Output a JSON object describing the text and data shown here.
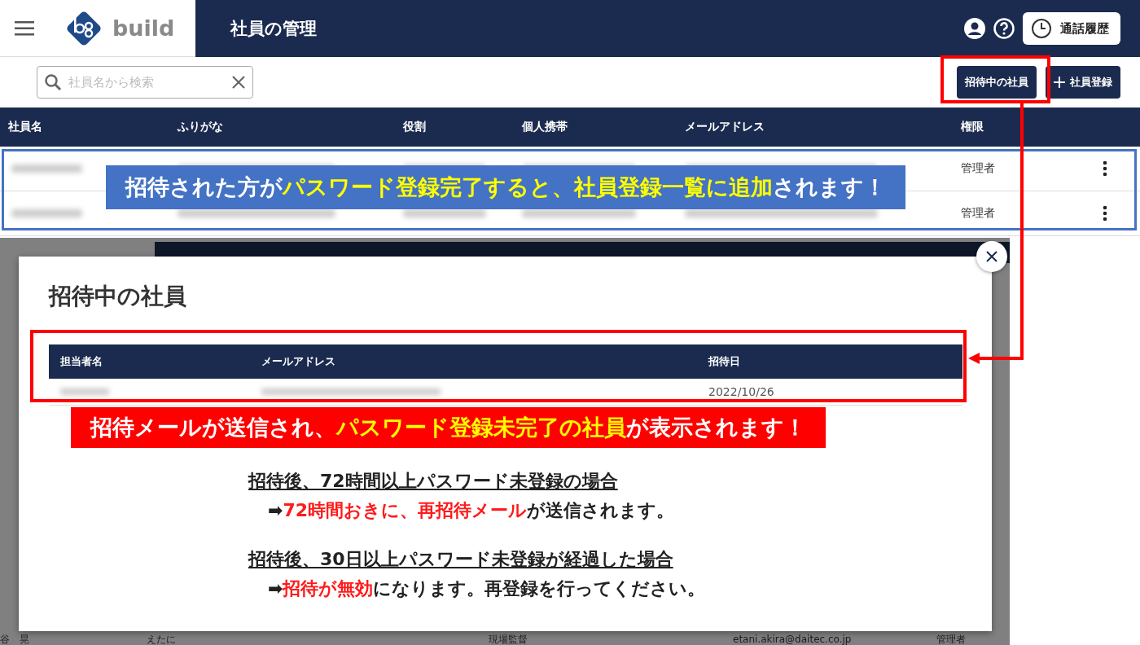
{
  "header": {
    "logo_text": "build",
    "title": "社員の管理",
    "history_button": "通話履歴"
  },
  "toolbar": {
    "search": {
      "placeholder": "社員名から検索"
    },
    "buttons": [
      {
        "kind": "invited",
        "label": "招待中の社員"
      },
      {
        "kind": "add",
        "label": "社員登録"
      }
    ]
  },
  "table": {
    "columns": [
      "社員名",
      "ふりがな",
      "役割",
      "個人携帯",
      "メールアドレス",
      "権限"
    ],
    "rows": [
      {
        "authority": "管理者"
      },
      {
        "authority": "管理者"
      }
    ]
  },
  "background_row": {
    "cells": [
      "谷　晃",
      "えたに",
      "現場監督",
      "etani.akira@daitec.co.jp",
      "管理者"
    ]
  },
  "modal": {
    "title": "招待中の社員",
    "columns": [
      "担当者名",
      "メールアドレス",
      "招待日"
    ],
    "rows": [
      {
        "invited_date": "2022/10/26"
      }
    ],
    "notes": [
      {
        "heading": "招待後、72時間以上パスワード未登録の場合",
        "arrow": "➡",
        "segments": [
          {
            "text": "72時間おきに、再招待メール",
            "highlight": true
          },
          {
            "text": "が送信されます。",
            "highlight": false
          }
        ]
      },
      {
        "heading": "招待後、30日以上パスワード未登録が経過した場合",
        "arrow": "➡",
        "segments": [
          {
            "text": "招待が無効",
            "highlight": true
          },
          {
            "text": "になります。再登録を行ってください。",
            "highlight": false
          }
        ]
      }
    ]
  },
  "callouts": [
    {
      "kind": "blue",
      "segments": [
        {
          "text": "招待された方が",
          "highlight": false
        },
        {
          "text": "パスワード登録完了すると、社員登録一覧に追加",
          "highlight": true
        },
        {
          "text": "されます！",
          "highlight": false
        }
      ]
    },
    {
      "kind": "red",
      "segments": [
        {
          "text": "招待メールが送信され、",
          "highlight": false
        },
        {
          "text": "パスワード登録未完了の社員",
          "highlight": true
        },
        {
          "text": "が表示されます！",
          "highlight": false
        }
      ]
    }
  ]
}
